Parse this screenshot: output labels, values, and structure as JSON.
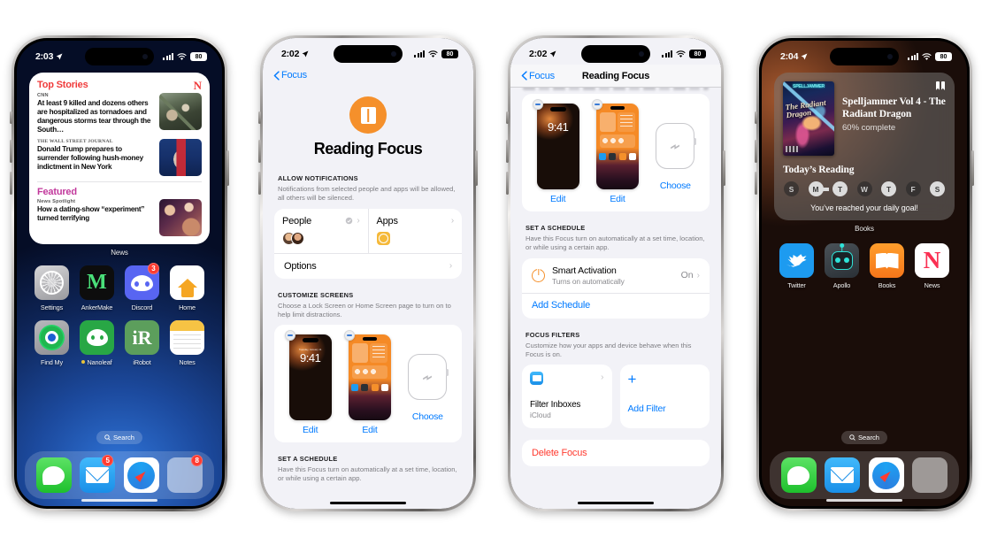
{
  "phones": {
    "phone1": {
      "name": "iphone-home-screen-news",
      "status": {
        "time": "2:03",
        "battery": "80",
        "location_icon": "location-arrow-icon",
        "cellular_icon": "cellular-bars-icon",
        "wifi_icon": "wifi-icon"
      },
      "news_widget": {
        "section1_title": "Top Stories",
        "logo": "news-app-logo",
        "stories": [
          {
            "source": "CNN",
            "headline": "At least 9 killed and dozens others are hospitalized as tornadoes and dangerous storms tear through the South…",
            "thumb": "storm-damage-photo"
          },
          {
            "source": "THE WALL STREET JOURNAL",
            "headline": "Donald Trump prepares to surrender following hush-money indictment in New York",
            "thumb": "trump-podium-photo"
          }
        ],
        "section2_title": "Featured",
        "featured": {
          "source": "News Spotlight",
          "headline": "How a dating-show “experiment” turned terrifying",
          "thumb": "dating-show-photo"
        },
        "widget_label": "News"
      },
      "apps": [
        {
          "label": "Settings",
          "icon": "settings-gear-icon",
          "badge": ""
        },
        {
          "label": "AnkerMake",
          "icon": "ankermake-icon",
          "badge": ""
        },
        {
          "label": "Discord",
          "icon": "discord-icon",
          "badge": "3"
        },
        {
          "label": "Home",
          "icon": "home-app-icon",
          "badge": ""
        },
        {
          "label": "Find My",
          "icon": "find-my-icon",
          "badge": ""
        },
        {
          "label": "Nanoleaf",
          "icon": "nanoleaf-icon",
          "badge": "",
          "dot": true
        },
        {
          "label": "iRobot",
          "icon": "irobot-icon",
          "badge": ""
        },
        {
          "label": "Notes",
          "icon": "notes-icon",
          "badge": ""
        }
      ],
      "search_pill": "Search",
      "dock": [
        {
          "label": "Messages",
          "icon": "messages-icon",
          "badge": ""
        },
        {
          "label": "Mail",
          "icon": "mail-icon",
          "badge": "5"
        },
        {
          "label": "Safari",
          "icon": "safari-icon",
          "badge": ""
        },
        {
          "label": "Folder",
          "icon": "app-folder-icon",
          "badge": "8"
        }
      ]
    },
    "phone2": {
      "name": "reading-focus-settings-top",
      "status": {
        "time": "2:02",
        "battery": "80"
      },
      "nav": {
        "back_label": "Focus"
      },
      "hero": {
        "icon": "book-focus-icon",
        "title": "Reading Focus"
      },
      "allow_notifications": {
        "header": "ALLOW NOTIFICATIONS",
        "description": "Notifications from selected people and apps will be allowed, all others will be silenced.",
        "people_label": "People",
        "apps_label": "Apps",
        "options_label": "Options"
      },
      "customize_screens": {
        "header": "CUSTOMIZE SCREENS",
        "description": "Choose a Lock Screen or Home Screen page to turn on to help limit distractions.",
        "lock_time": "9:41",
        "lock_date": "Tuesday, January 11",
        "items": [
          {
            "type": "lock-screen",
            "action": "Edit"
          },
          {
            "type": "home-screen",
            "action": "Edit"
          },
          {
            "type": "watch-face",
            "action": "Choose"
          }
        ]
      },
      "set_schedule": {
        "header": "SET A SCHEDULE",
        "description": "Have this Focus turn on automatically at a set time, location, or while using a certain app."
      }
    },
    "phone3": {
      "name": "reading-focus-settings-scrolled",
      "status": {
        "time": "2:02",
        "battery": "80"
      },
      "nav": {
        "back_label": "Focus",
        "title": "Reading Focus"
      },
      "customize_screens": {
        "lock_time": "9:41",
        "items": [
          {
            "type": "lock-screen",
            "action": "Edit"
          },
          {
            "type": "home-screen",
            "action": "Edit"
          },
          {
            "type": "watch-face",
            "action": "Choose"
          }
        ]
      },
      "set_schedule": {
        "header": "SET A SCHEDULE",
        "description": "Have this Focus turn on automatically at a set time, location, or while using a certain app.",
        "smart_activation": {
          "title": "Smart Activation",
          "subtitle": "Turns on automatically",
          "value": "On",
          "icon": "power-icon"
        },
        "add_schedule": "Add Schedule"
      },
      "focus_filters": {
        "header": "FOCUS FILTERS",
        "description": "Customize how your apps and device behave when this Focus is on.",
        "filter": {
          "name": "Filter Inboxes",
          "subtitle": "iCloud",
          "icon": "mail-filter-icon"
        },
        "add_filter": "Add Filter",
        "add_icon": "plus-icon"
      },
      "delete_focus": "Delete Focus"
    },
    "phone4": {
      "name": "iphone-home-screen-books",
      "status": {
        "time": "2:04",
        "battery": "80"
      },
      "books_widget": {
        "bookmark_icon": "bookmark-icon",
        "book_title": "Spelljammer Vol 4 - The Radiant Dragon",
        "progress": "60% complete",
        "cover_top_text": "SPELLJAMMER",
        "cover_title": "The Radiant Dragon",
        "today_header": "Today’s Reading",
        "days": [
          {
            "letter": "S",
            "state": "off"
          },
          {
            "letter": "M",
            "state": "on"
          },
          {
            "letter": "T",
            "state": "on"
          },
          {
            "letter": "W",
            "state": "off"
          },
          {
            "letter": "T",
            "state": "on"
          },
          {
            "letter": "F",
            "state": "off"
          },
          {
            "letter": "S",
            "state": "on"
          }
        ],
        "goal_text": "You’ve reached your daily goal!",
        "widget_label": "Books"
      },
      "apps": [
        {
          "label": "Twitter",
          "icon": "twitter-icon"
        },
        {
          "label": "Apollo",
          "icon": "apollo-icon"
        },
        {
          "label": "Books",
          "icon": "books-icon"
        },
        {
          "label": "News",
          "icon": "news-icon"
        }
      ],
      "search_pill": "Search",
      "dock": [
        {
          "label": "Messages",
          "icon": "messages-icon"
        },
        {
          "label": "Mail",
          "icon": "mail-icon"
        },
        {
          "label": "Safari",
          "icon": "safari-icon"
        },
        {
          "label": "Folder",
          "icon": "app-folder-icon"
        }
      ]
    }
  },
  "colors": {
    "ios_blue": "#007aff",
    "focus_orange": "#f5902b",
    "destructive_red": "#ff3b30",
    "news_red": "#f03b3b",
    "featured_pink": "#c2399c"
  }
}
